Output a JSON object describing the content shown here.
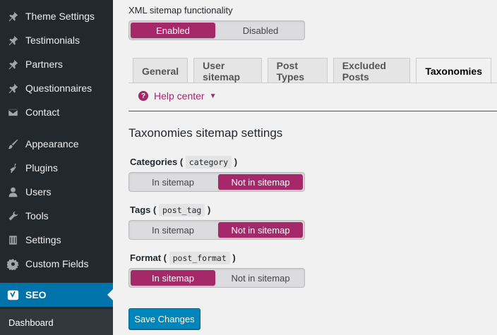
{
  "sidebar": {
    "items": [
      {
        "label": "Theme Settings",
        "icon": "pin-icon"
      },
      {
        "label": "Testimonials",
        "icon": "pin-icon"
      },
      {
        "label": "Partners",
        "icon": "pin-icon"
      },
      {
        "label": "Questionnaires",
        "icon": "pin-icon"
      },
      {
        "label": "Contact",
        "icon": "envelope-icon"
      },
      {
        "label": "Appearance",
        "icon": "paintbrush-icon"
      },
      {
        "label": "Plugins",
        "icon": "plug-icon"
      },
      {
        "label": "Users",
        "icon": "user-icon"
      },
      {
        "label": "Tools",
        "icon": "wrench-icon"
      },
      {
        "label": "Settings",
        "icon": "sliders-icon"
      },
      {
        "label": "Custom Fields",
        "icon": "gear-icon"
      },
      {
        "label": "SEO",
        "icon": "yoast-icon"
      }
    ],
    "active_index": 11,
    "submenu": {
      "label": "Dashboard"
    }
  },
  "main": {
    "xml_sitemap": {
      "label": "XML sitemap functionality",
      "options": [
        "Enabled",
        "Disabled"
      ],
      "selected": "Enabled"
    },
    "tabs": [
      {
        "label": "General"
      },
      {
        "label": "User sitemap"
      },
      {
        "label": "Post Types"
      },
      {
        "label": "Excluded Posts"
      },
      {
        "label": "Taxonomies"
      }
    ],
    "active_tab": "Taxonomies",
    "help_center": {
      "label": "Help center"
    },
    "section_title": "Taxonomies sitemap settings",
    "taxonomies": [
      {
        "name": "Categories",
        "slug": "category",
        "options": [
          "In sitemap",
          "Not in sitemap"
        ],
        "selected": "Not in sitemap"
      },
      {
        "name": "Tags",
        "slug": "post_tag",
        "options": [
          "In sitemap",
          "Not in sitemap"
        ],
        "selected": "Not in sitemap"
      },
      {
        "name": "Format",
        "slug": "post_format",
        "options": [
          "In sitemap",
          "Not in sitemap"
        ],
        "selected": "In sitemap"
      }
    ],
    "save_label": "Save Changes"
  },
  "colors": {
    "sidebar_bg": "#23282d",
    "active_menu": "#0073aa",
    "accent": "#a4286a",
    "button": "#0085ba"
  }
}
